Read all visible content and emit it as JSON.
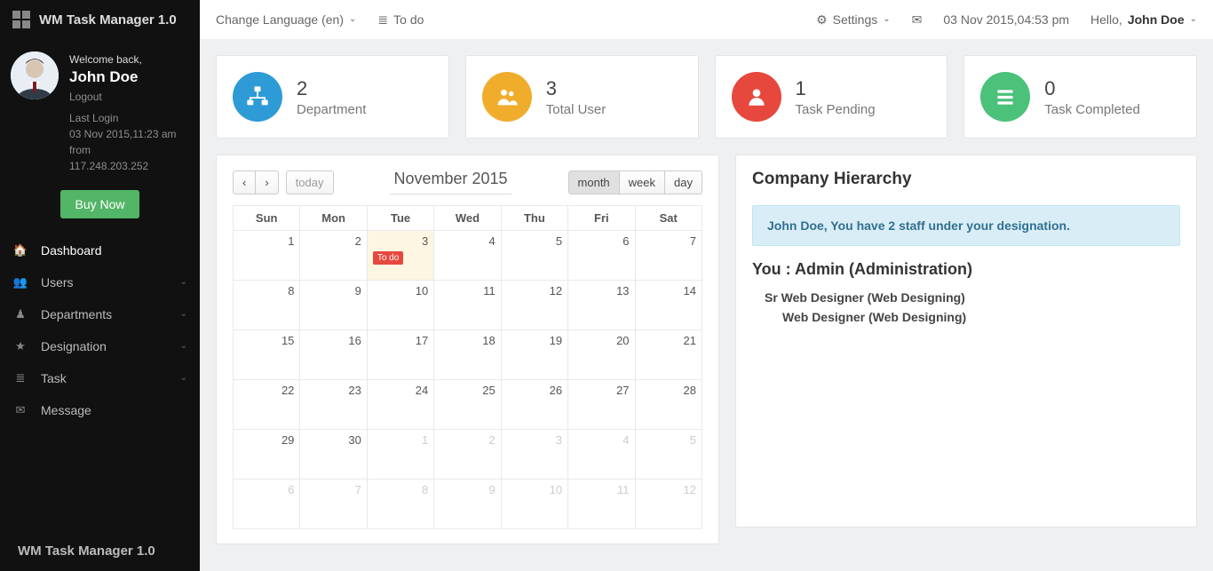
{
  "brand": {
    "title": "WM Task Manager 1.0"
  },
  "profile": {
    "welcome": "Welcome back,",
    "name": "John Doe",
    "logout": "Logout",
    "last_login_label": "Last Login",
    "last_login_time": "03 Nov 2015,11:23 am",
    "from_label": "from",
    "from_ip": "117.248.203.252"
  },
  "buy_now": "Buy Now",
  "nav": {
    "dashboard": "Dashboard",
    "users": "Users",
    "departments": "Departments",
    "designation": "Designation",
    "task": "Task",
    "message": "Message"
  },
  "topbar": {
    "language": "Change Language (en)",
    "todo": "To do",
    "settings": "Settings",
    "datetime": "03 Nov 2015,04:53 pm",
    "hello_prefix": "Hello, ",
    "hello_name": "John Doe"
  },
  "stats": [
    {
      "value": "2",
      "label": "Department"
    },
    {
      "value": "3",
      "label": "Total User"
    },
    {
      "value": "1",
      "label": "Task Pending"
    },
    {
      "value": "0",
      "label": "Task Completed"
    }
  ],
  "calendar": {
    "today": "today",
    "title": "November 2015",
    "view_month": "month",
    "view_week": "week",
    "view_day": "day",
    "days": [
      "Sun",
      "Mon",
      "Tue",
      "Wed",
      "Thu",
      "Fri",
      "Sat"
    ],
    "weeks": [
      [
        {
          "n": "1"
        },
        {
          "n": "2"
        },
        {
          "n": "3",
          "today": true,
          "event": "To do"
        },
        {
          "n": "4"
        },
        {
          "n": "5"
        },
        {
          "n": "6"
        },
        {
          "n": "7"
        }
      ],
      [
        {
          "n": "8"
        },
        {
          "n": "9"
        },
        {
          "n": "10"
        },
        {
          "n": "11"
        },
        {
          "n": "12"
        },
        {
          "n": "13"
        },
        {
          "n": "14"
        }
      ],
      [
        {
          "n": "15"
        },
        {
          "n": "16"
        },
        {
          "n": "17"
        },
        {
          "n": "18"
        },
        {
          "n": "19"
        },
        {
          "n": "20"
        },
        {
          "n": "21"
        }
      ],
      [
        {
          "n": "22"
        },
        {
          "n": "23"
        },
        {
          "n": "24"
        },
        {
          "n": "25"
        },
        {
          "n": "26"
        },
        {
          "n": "27"
        },
        {
          "n": "28"
        }
      ],
      [
        {
          "n": "29"
        },
        {
          "n": "30"
        },
        {
          "n": "1",
          "other": true
        },
        {
          "n": "2",
          "other": true
        },
        {
          "n": "3",
          "other": true
        },
        {
          "n": "4",
          "other": true
        },
        {
          "n": "5",
          "other": true
        }
      ],
      [
        {
          "n": "6",
          "other": true
        },
        {
          "n": "7",
          "other": true
        },
        {
          "n": "8",
          "other": true
        },
        {
          "n": "9",
          "other": true
        },
        {
          "n": "10",
          "other": true
        },
        {
          "n": "11",
          "other": true
        },
        {
          "n": "12",
          "other": true
        }
      ]
    ]
  },
  "hierarchy": {
    "title": "Company Hierarchy",
    "alert": "John Doe, You have 2 staff under your designation.",
    "you_line": "You : Admin (Administration)",
    "tree": [
      {
        "level": 1,
        "text": "Sr Web Designer (Web Designing)"
      },
      {
        "level": 2,
        "text": "Web Designer (Web Designing)"
      }
    ]
  },
  "footer_brand": "WM Task Manager 1.0"
}
